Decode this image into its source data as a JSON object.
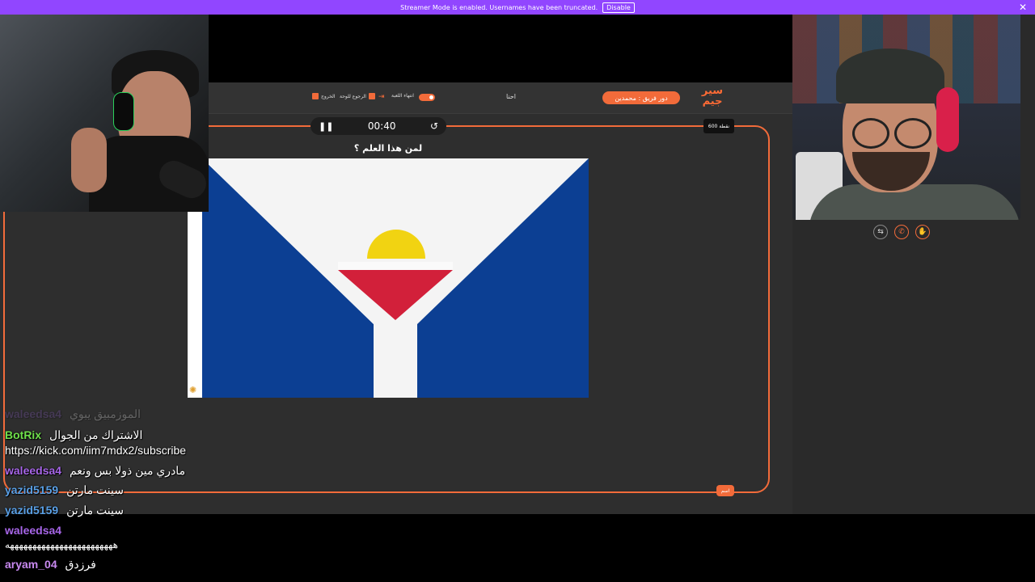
{
  "banner": {
    "text": "Streamer Mode is enabled. Usernames have been truncated.",
    "disable_label": "Disable",
    "color": "#9146ff"
  },
  "game": {
    "logo_text": "سير جيم",
    "team_label": "دور فريق : محمدين",
    "team_name": "احنا",
    "buttons": {
      "end_game": "انتهاء اللعبة",
      "back_board": "الرجوع للوحة",
      "exit": "الخروج"
    },
    "timer": "00:40",
    "points_badge": "600 نقطة",
    "question": "لمن هذا العلم ؟",
    "answer_button": "اسم",
    "accent": "#f26b3a"
  },
  "call": {
    "buttons": [
      "swap-icon",
      "phone-icon",
      "hand-icon"
    ]
  },
  "chat": [
    {
      "user": "waleedsa4",
      "msg": "الموزمبيق يبوي",
      "color": "#8a5cc8",
      "faded": true
    },
    {
      "user": "BotRix",
      "msg": "الاشتراك من الجوال",
      "color": "#6fe04b"
    },
    {
      "user": "",
      "msg": "https://kick.com/iim7mdx2/subscribe",
      "color": "#ffffff"
    },
    {
      "user": "waleedsa4",
      "msg": "مادري مين ذولا بس ونعم",
      "color": "#a766e8"
    },
    {
      "user": "yazid5159",
      "msg": "سينت مارتن",
      "color": "#5aa0e6"
    },
    {
      "user": "yazid5159",
      "msg": "سينت مارتن",
      "color": "#5aa0e6"
    },
    {
      "user": "waleedsa4",
      "msg": "",
      "color": "#a766e8"
    },
    {
      "user": "",
      "msg": "ههههههههههههههههههههههههه",
      "color": "#ffffff"
    },
    {
      "user": "aryam_04",
      "msg": "فرزدق",
      "color": "#c889f0"
    }
  ]
}
